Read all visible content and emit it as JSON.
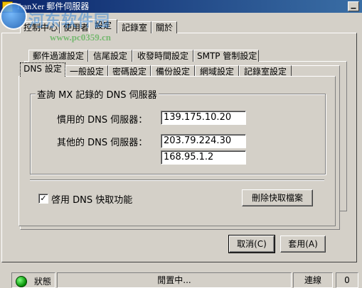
{
  "window": {
    "title": "TranXer 郵件伺服器",
    "minimize_glyph": "▁"
  },
  "watermark": {
    "title": "河东软件园",
    "url": "www.pc0359.cn"
  },
  "main_tabs": [
    {
      "label": "控制中心"
    },
    {
      "label": "使用者"
    },
    {
      "label": "設定"
    },
    {
      "label": "記錄室"
    },
    {
      "label": "關於"
    }
  ],
  "settings_tabs_row1": [
    {
      "label": "郵件過濾設定"
    },
    {
      "label": "信尾設定"
    },
    {
      "label": "收發時間設定"
    },
    {
      "label": "SMTP 管制設定"
    }
  ],
  "settings_tabs_row2": [
    {
      "label": "DNS 設定"
    },
    {
      "label": "一般設定"
    },
    {
      "label": "密碼設定"
    },
    {
      "label": "備份設定"
    },
    {
      "label": "網域設定"
    },
    {
      "label": "記錄室設定"
    }
  ],
  "dns": {
    "group_title": "查詢 MX 記錄的 DNS 伺服器",
    "preferred_label": "慣用的 DNS 伺服器：",
    "preferred_value": "139.175.10.20",
    "other_label": "其他的 DNS 伺服器：",
    "other_value_1": "203.79.224.30",
    "other_value_2": "168.95.1.2",
    "cache_checkbox_label": "啓用 DNS 快取功能",
    "cache_checked": true,
    "clear_cache_button": "刪除快取檔案"
  },
  "dialog_buttons": {
    "cancel": "取消(C)",
    "apply": "套用(A)"
  },
  "status_bar": {
    "state_label": "狀態",
    "state_text": "閒置中...",
    "connection_label": "連線",
    "connection_count": "0",
    "led_color": "#00aa00"
  },
  "icons": {
    "app": "app-icon",
    "status": "status-led-icon",
    "check": "✓"
  }
}
